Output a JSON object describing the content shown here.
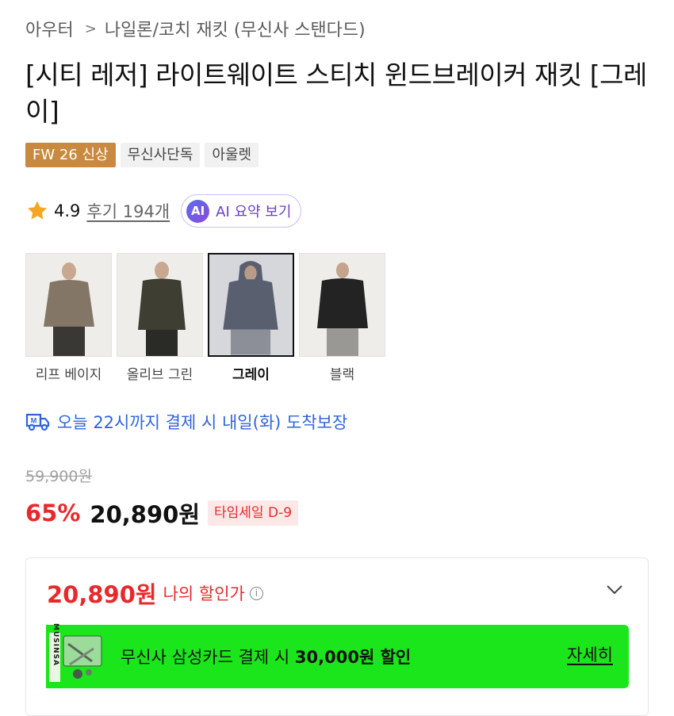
{
  "breadcrumb": {
    "parent": "아우터",
    "separator": ">",
    "current": "나일론/코치 재킷 (무신사 스탠다드)"
  },
  "product": {
    "title": "[시티 레저] 라이트웨이트 스티치 윈드브레이커 재킷 [그레이]"
  },
  "badges": [
    "FW 26 신상",
    "무신사단독",
    "아울렛"
  ],
  "rating": {
    "score": "4.9",
    "reviews": "후기 194개",
    "ai_badge": "AI",
    "ai_summary": "AI 요약 보기"
  },
  "variants": [
    {
      "label": "리프 베이지",
      "selected": false,
      "jacket_color": "#837666",
      "pants_color": "#3a3835"
    },
    {
      "label": "올리브 그린",
      "selected": false,
      "jacket_color": "#3f3e32",
      "pants_color": "#2a2a26"
    },
    {
      "label": "그레이",
      "selected": true,
      "jacket_color": "#5a5f70",
      "pants_color": "#8c8f98"
    },
    {
      "label": "블랙",
      "selected": false,
      "jacket_color": "#232323",
      "pants_color": "#9a9894"
    }
  ],
  "delivery": {
    "text": "오늘 22시까지 결제 시 내일(화) 도착보장"
  },
  "price": {
    "original": "59,900원",
    "discount": "65%",
    "sale": "20,890원",
    "timesale": "타임세일 D-9"
  },
  "benefit": {
    "my_price": "20,890원",
    "my_price_label": "나의 할인가",
    "card_offer_prefix": "무신사 삼성카드 결제 시 ",
    "card_offer_amount": "30,000원 할인",
    "card_link": "자세히",
    "card_brand": "MUSINSA"
  },
  "colors": {
    "accent_red": "#e8292c",
    "link_blue": "#2f64d9",
    "banner_green": "#1be61b",
    "new_badge": "#c98a3f"
  }
}
